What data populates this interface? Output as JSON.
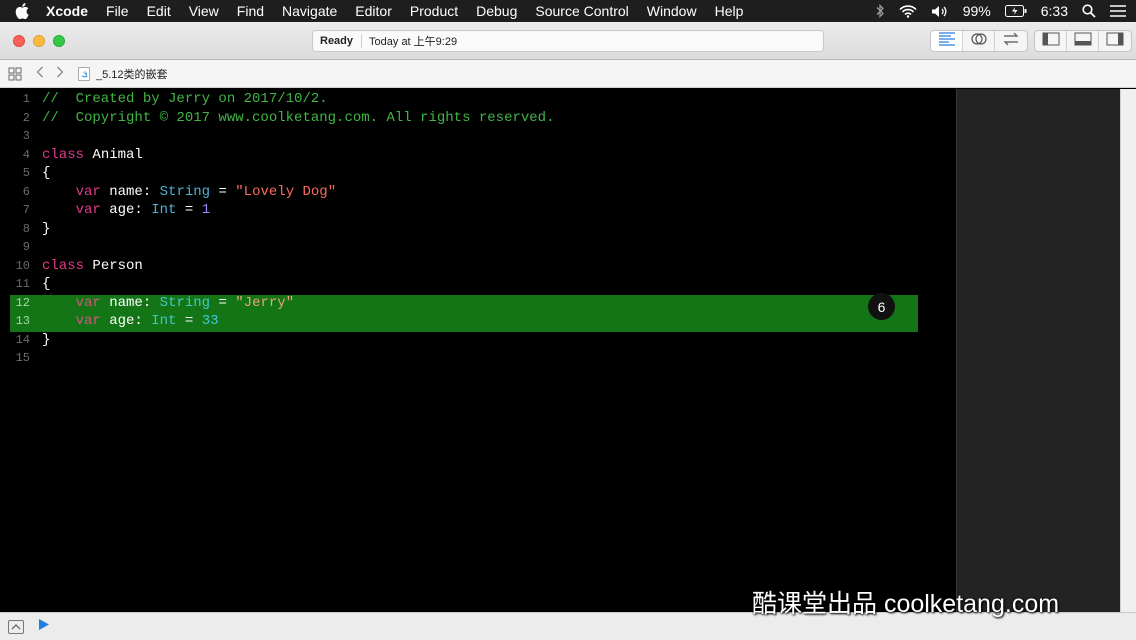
{
  "menubar": {
    "app_name": "Xcode",
    "items": [
      "File",
      "Edit",
      "View",
      "Find",
      "Navigate",
      "Editor",
      "Product",
      "Debug",
      "Source Control",
      "Window",
      "Help"
    ],
    "battery": "99%",
    "time": "6:33"
  },
  "toolbar": {
    "status_ready": "Ready",
    "status_time": "Today at 上午9:29"
  },
  "jumpbar": {
    "file_name": "_5.12类的嵌套"
  },
  "editor": {
    "lines": [
      {
        "n": "1",
        "tokens": [
          {
            "t": "//  Created by Jerry on 2017/10/2.",
            "c": "c-comment"
          }
        ]
      },
      {
        "n": "2",
        "tokens": [
          {
            "t": "//  Copyright © 2017 www.coolketang.com. All rights reserved.",
            "c": "c-comment"
          }
        ]
      },
      {
        "n": "3",
        "tokens": []
      },
      {
        "n": "4",
        "tokens": [
          {
            "t": "class",
            "c": "c-kw"
          },
          {
            "t": " Animal",
            "c": ""
          }
        ]
      },
      {
        "n": "5",
        "tokens": [
          {
            "t": "{",
            "c": ""
          }
        ]
      },
      {
        "n": "6",
        "tokens": [
          {
            "t": "    ",
            "c": ""
          },
          {
            "t": "var",
            "c": "c-kw"
          },
          {
            "t": " name: ",
            "c": ""
          },
          {
            "t": "String",
            "c": "c-type"
          },
          {
            "t": " = ",
            "c": ""
          },
          {
            "t": "\"Lovely Dog\"",
            "c": "c-str"
          }
        ]
      },
      {
        "n": "7",
        "tokens": [
          {
            "t": "    ",
            "c": ""
          },
          {
            "t": "var",
            "c": "c-kw"
          },
          {
            "t": " age: ",
            "c": ""
          },
          {
            "t": "Int",
            "c": "c-type"
          },
          {
            "t": " = ",
            "c": ""
          },
          {
            "t": "1",
            "c": "c-num"
          }
        ]
      },
      {
        "n": "8",
        "tokens": [
          {
            "t": "}",
            "c": ""
          }
        ]
      },
      {
        "n": "9",
        "tokens": []
      },
      {
        "n": "10",
        "tokens": [
          {
            "t": "class",
            "c": "c-kw"
          },
          {
            "t": " Person",
            "c": ""
          }
        ]
      },
      {
        "n": "11",
        "tokens": [
          {
            "t": "{",
            "c": ""
          }
        ]
      },
      {
        "n": "12",
        "hl": true,
        "tokens": [
          {
            "t": "    ",
            "c": ""
          },
          {
            "t": "var",
            "c": "c-kw"
          },
          {
            "t": " name: ",
            "c": ""
          },
          {
            "t": "String",
            "c": "c-type"
          },
          {
            "t": " = ",
            "c": ""
          },
          {
            "t": "\"Jerry\"",
            "c": "c-str"
          }
        ]
      },
      {
        "n": "13",
        "hl": true,
        "tokens": [
          {
            "t": "    ",
            "c": ""
          },
          {
            "t": "var",
            "c": "c-kw"
          },
          {
            "t": " age: ",
            "c": ""
          },
          {
            "t": "Int",
            "c": "c-type"
          },
          {
            "t": " = ",
            "c": ""
          },
          {
            "t": "33",
            "c": "c-num"
          }
        ]
      },
      {
        "n": "14",
        "tokens": [
          {
            "t": "}",
            "c": ""
          }
        ]
      },
      {
        "n": "15",
        "tokens": []
      }
    ],
    "step_badge": "6"
  },
  "watermark": "酷课堂出品 coolketang.com"
}
